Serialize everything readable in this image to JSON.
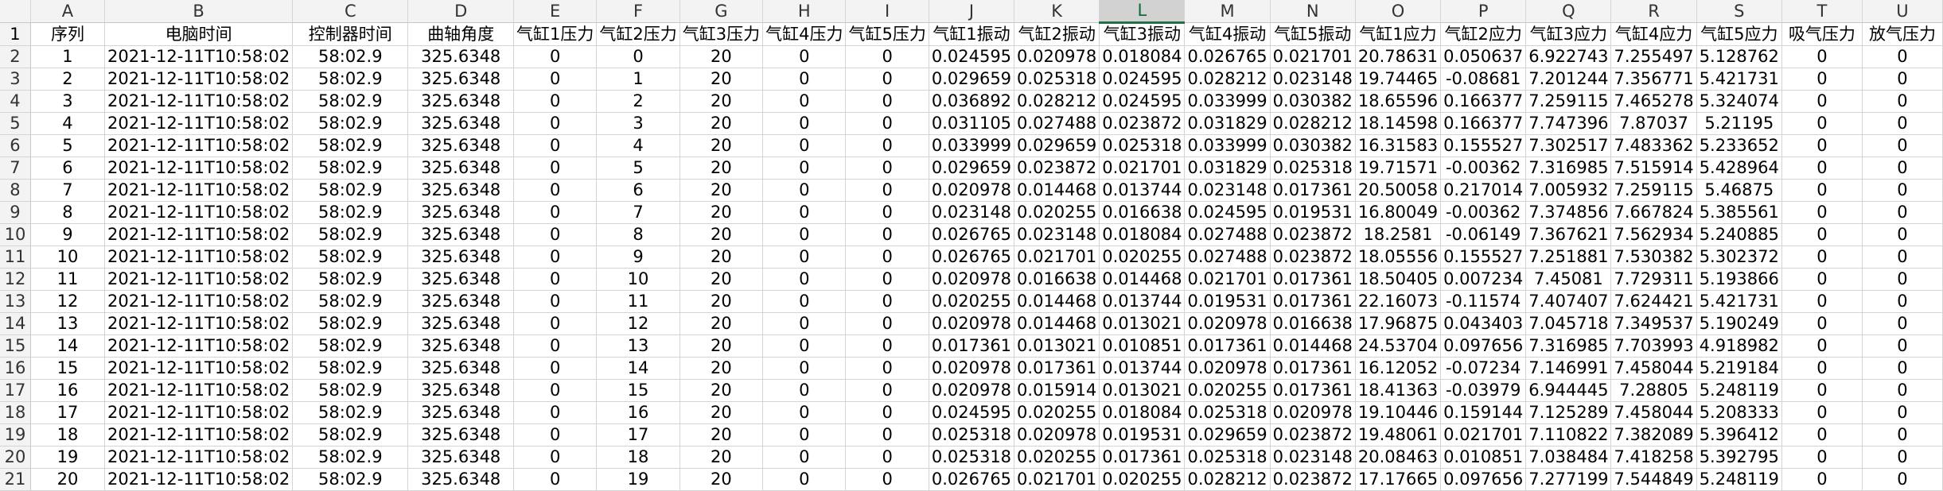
{
  "column_letters": [
    "A",
    "B",
    "C",
    "D",
    "E",
    "F",
    "G",
    "H",
    "I",
    "J",
    "K",
    "L",
    "M",
    "N",
    "O",
    "P",
    "Q",
    "R",
    "S",
    "T",
    "U"
  ],
  "selected_column": "L",
  "header_row_number": "1",
  "header_labels": [
    "序列",
    "电脑时间",
    "控制器时间",
    "曲轴角度",
    "气缸1压力",
    "气缸2压力",
    "气缸3压力",
    "气缸4压力",
    "气缸5压力",
    "气缸1振动",
    "气缸2振动",
    "气缸3振动",
    "气缸4振动",
    "气缸5振动",
    "气缸1应力",
    "气缸2应力",
    "气缸3应力",
    "气缸4应力",
    "气缸5应力",
    "吸气压力",
    "放气压力"
  ],
  "rows": [
    {
      "num": "2",
      "cells": [
        "1",
        "2021-12-11T10:58:02",
        "58:02.9",
        "325.6348",
        "0",
        "0",
        "20",
        "0",
        "0",
        "0.024595",
        "0.020978",
        "0.018084",
        "0.026765",
        "0.021701",
        "20.78631",
        "0.050637",
        "6.922743",
        "7.255497",
        "5.128762",
        "0",
        "0"
      ]
    },
    {
      "num": "3",
      "cells": [
        "2",
        "2021-12-11T10:58:02",
        "58:02.9",
        "325.6348",
        "0",
        "1",
        "20",
        "0",
        "0",
        "0.029659",
        "0.025318",
        "0.024595",
        "0.028212",
        "0.023148",
        "19.74465",
        "-0.08681",
        "7.201244",
        "7.356771",
        "5.421731",
        "0",
        "0"
      ]
    },
    {
      "num": "4",
      "cells": [
        "3",
        "2021-12-11T10:58:02",
        "58:02.9",
        "325.6348",
        "0",
        "2",
        "20",
        "0",
        "0",
        "0.036892",
        "0.028212",
        "0.024595",
        "0.033999",
        "0.030382",
        "18.65596",
        "0.166377",
        "7.259115",
        "7.465278",
        "5.324074",
        "0",
        "0"
      ]
    },
    {
      "num": "5",
      "cells": [
        "4",
        "2021-12-11T10:58:02",
        "58:02.9",
        "325.6348",
        "0",
        "3",
        "20",
        "0",
        "0",
        "0.031105",
        "0.027488",
        "0.023872",
        "0.031829",
        "0.028212",
        "18.14598",
        "0.166377",
        "7.747396",
        "7.87037",
        "5.21195",
        "0",
        "0"
      ]
    },
    {
      "num": "6",
      "cells": [
        "5",
        "2021-12-11T10:58:02",
        "58:02.9",
        "325.6348",
        "0",
        "4",
        "20",
        "0",
        "0",
        "0.033999",
        "0.029659",
        "0.025318",
        "0.033999",
        "0.030382",
        "16.31583",
        "0.155527",
        "7.302517",
        "7.483362",
        "5.233652",
        "0",
        "0"
      ]
    },
    {
      "num": "7",
      "cells": [
        "6",
        "2021-12-11T10:58:02",
        "58:02.9",
        "325.6348",
        "0",
        "5",
        "20",
        "0",
        "0",
        "0.029659",
        "0.023872",
        "0.021701",
        "0.031829",
        "0.025318",
        "19.71571",
        "-0.00362",
        "7.316985",
        "7.515914",
        "5.428964",
        "0",
        "0"
      ]
    },
    {
      "num": "8",
      "cells": [
        "7",
        "2021-12-11T10:58:02",
        "58:02.9",
        "325.6348",
        "0",
        "6",
        "20",
        "0",
        "0",
        "0.020978",
        "0.014468",
        "0.013744",
        "0.023148",
        "0.017361",
        "20.50058",
        "0.217014",
        "7.005932",
        "7.259115",
        "5.46875",
        "0",
        "0"
      ]
    },
    {
      "num": "9",
      "cells": [
        "8",
        "2021-12-11T10:58:02",
        "58:02.9",
        "325.6348",
        "0",
        "7",
        "20",
        "0",
        "0",
        "0.023148",
        "0.020255",
        "0.016638",
        "0.024595",
        "0.019531",
        "16.80049",
        "-0.00362",
        "7.374856",
        "7.667824",
        "5.385561",
        "0",
        "0"
      ]
    },
    {
      "num": "10",
      "cells": [
        "9",
        "2021-12-11T10:58:02",
        "58:02.9",
        "325.6348",
        "0",
        "8",
        "20",
        "0",
        "0",
        "0.026765",
        "0.023148",
        "0.018084",
        "0.027488",
        "0.023872",
        "18.2581",
        "-0.06149",
        "7.367621",
        "7.562934",
        "5.240885",
        "0",
        "0"
      ]
    },
    {
      "num": "11",
      "cells": [
        "10",
        "2021-12-11T10:58:02",
        "58:02.9",
        "325.6348",
        "0",
        "9",
        "20",
        "0",
        "0",
        "0.026765",
        "0.021701",
        "0.020255",
        "0.027488",
        "0.023872",
        "18.05556",
        "0.155527",
        "7.251881",
        "7.530382",
        "5.302372",
        "0",
        "0"
      ]
    },
    {
      "num": "12",
      "cells": [
        "11",
        "2021-12-11T10:58:02",
        "58:02.9",
        "325.6348",
        "0",
        "10",
        "20",
        "0",
        "0",
        "0.020978",
        "0.016638",
        "0.014468",
        "0.021701",
        "0.017361",
        "18.50405",
        "0.007234",
        "7.45081",
        "7.729311",
        "5.193866",
        "0",
        "0"
      ]
    },
    {
      "num": "13",
      "cells": [
        "12",
        "2021-12-11T10:58:02",
        "58:02.9",
        "325.6348",
        "0",
        "11",
        "20",
        "0",
        "0",
        "0.020255",
        "0.014468",
        "0.013744",
        "0.019531",
        "0.017361",
        "22.16073",
        "-0.11574",
        "7.407407",
        "7.624421",
        "5.421731",
        "0",
        "0"
      ]
    },
    {
      "num": "14",
      "cells": [
        "13",
        "2021-12-11T10:58:02",
        "58:02.9",
        "325.6348",
        "0",
        "12",
        "20",
        "0",
        "0",
        "0.020978",
        "0.014468",
        "0.013021",
        "0.020978",
        "0.016638",
        "17.96875",
        "0.043403",
        "7.045718",
        "7.349537",
        "5.190249",
        "0",
        "0"
      ]
    },
    {
      "num": "15",
      "cells": [
        "14",
        "2021-12-11T10:58:02",
        "58:02.9",
        "325.6348",
        "0",
        "13",
        "20",
        "0",
        "0",
        "0.017361",
        "0.013021",
        "0.010851",
        "0.017361",
        "0.014468",
        "24.53704",
        "0.097656",
        "7.316985",
        "7.703993",
        "4.918982",
        "0",
        "0"
      ]
    },
    {
      "num": "16",
      "cells": [
        "15",
        "2021-12-11T10:58:02",
        "58:02.9",
        "325.6348",
        "0",
        "14",
        "20",
        "0",
        "0",
        "0.020978",
        "0.017361",
        "0.013744",
        "0.020978",
        "0.017361",
        "16.12052",
        "-0.07234",
        "7.146991",
        "7.458044",
        "5.219184",
        "0",
        "0"
      ]
    },
    {
      "num": "17",
      "cells": [
        "16",
        "2021-12-11T10:58:02",
        "58:02.9",
        "325.6348",
        "0",
        "15",
        "20",
        "0",
        "0",
        "0.020978",
        "0.015914",
        "0.013021",
        "0.020255",
        "0.017361",
        "18.41363",
        "-0.03979",
        "6.944445",
        "7.28805",
        "5.248119",
        "0",
        "0"
      ]
    },
    {
      "num": "18",
      "cells": [
        "17",
        "2021-12-11T10:58:02",
        "58:02.9",
        "325.6348",
        "0",
        "16",
        "20",
        "0",
        "0",
        "0.024595",
        "0.020255",
        "0.018084",
        "0.025318",
        "0.020978",
        "19.10446",
        "0.159144",
        "7.125289",
        "7.458044",
        "5.208333",
        "0",
        "0"
      ]
    },
    {
      "num": "19",
      "cells": [
        "18",
        "2021-12-11T10:58:02",
        "58:02.9",
        "325.6348",
        "0",
        "17",
        "20",
        "0",
        "0",
        "0.025318",
        "0.020978",
        "0.019531",
        "0.029659",
        "0.023872",
        "19.48061",
        "0.021701",
        "7.110822",
        "7.382089",
        "5.396412",
        "0",
        "0"
      ]
    },
    {
      "num": "20",
      "cells": [
        "19",
        "2021-12-11T10:58:02",
        "58:02.9",
        "325.6348",
        "0",
        "18",
        "20",
        "0",
        "0",
        "0.025318",
        "0.020255",
        "0.017361",
        "0.025318",
        "0.023148",
        "20.08463",
        "0.010851",
        "7.038484",
        "7.418258",
        "5.392795",
        "0",
        "0"
      ]
    },
    {
      "num": "21",
      "cells": [
        "20",
        "2021-12-11T10:58:02",
        "58:02.9",
        "325.6348",
        "0",
        "19",
        "20",
        "0",
        "0",
        "0.026765",
        "0.021701",
        "0.020255",
        "0.028212",
        "0.023872",
        "17.17665",
        "0.097656",
        "7.277199",
        "7.544849",
        "5.248119",
        "0",
        "0"
      ]
    }
  ]
}
